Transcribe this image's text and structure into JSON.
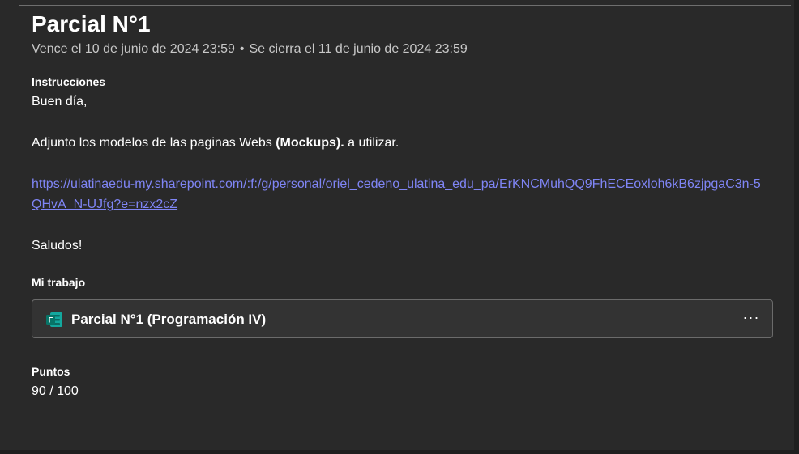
{
  "assignment": {
    "title": "Parcial N°1",
    "due": "Vence el 10 de junio de 2024 23:59",
    "separator": "•",
    "closes": "Se cierra el 11 de junio de 2024 23:59"
  },
  "instructions": {
    "label": "Instrucciones",
    "greeting": "Buen día,",
    "text_before": "Adjunto los modelos de las paginas Webs ",
    "text_bold": "(Mockups).",
    "text_after": " a utilizar.",
    "link": "https://ulatinaedu-my.sharepoint.com/:f:/g/personal/oriel_cedeno_ulatina_edu_pa/ErKNCMuhQQ9FhECEoxloh6kB6zjpgaC3n-5QHvA_N-UJfg?e=nzx2cZ",
    "closing": "Saludos!"
  },
  "my_work": {
    "label": "Mi trabajo",
    "attachment_title": "Parcial N°1 (Programación IV)",
    "attachment_icon": "microsoft-forms-icon",
    "more_label": "···"
  },
  "points": {
    "label": "Puntos",
    "value": "90 / 100"
  },
  "colors": {
    "background": "#292929",
    "link": "#7f85f5",
    "forms_green": "#0f7b6c"
  }
}
